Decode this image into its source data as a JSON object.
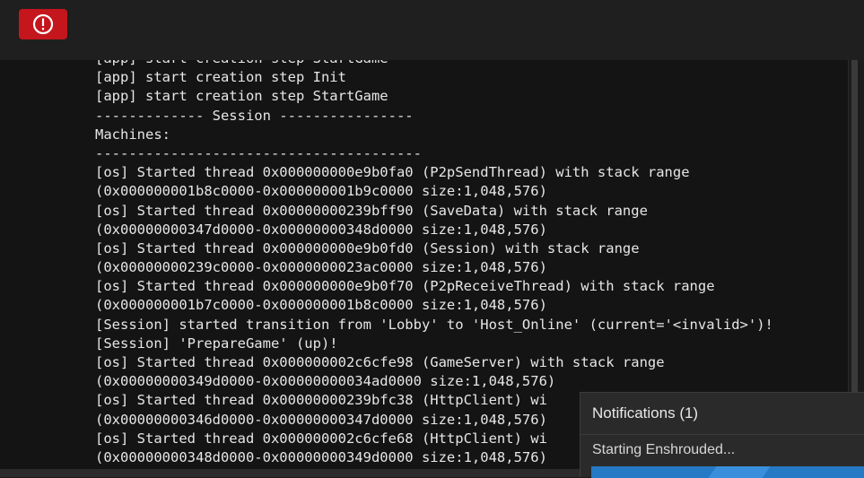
{
  "toolbar": {
    "alert_icon": "error-icon",
    "accent_color": "#c4161c"
  },
  "console": {
    "lines": [
      "[app] start creation step StartGame",
      "[app] start creation step Init",
      "[app] start creation step StartGame",
      "------------- Session ----------------",
      "Machines:",
      "---------------------------------------",
      "[os] Started thread 0x000000000e9b0fa0 (P2pSendThread) with stack range",
      "(0x000000001b8c0000-0x000000001b9c0000 size:1,048,576)",
      "[os] Started thread 0x00000000239bff90 (SaveData) with stack range",
      "(0x00000000347d0000-0x00000000348d0000 size:1,048,576)",
      "[os] Started thread 0x000000000e9b0fd0 (Session) with stack range",
      "(0x00000000239c0000-0x0000000023ac0000 size:1,048,576)",
      "[os] Started thread 0x000000000e9b0f70 (P2pReceiveThread) with stack range",
      "(0x000000001b7c0000-0x000000001b8c0000 size:1,048,576)",
      "[Session] started transition from 'Lobby' to 'Host_Online' (current='<invalid>')!",
      "[Session] 'PrepareGame' (up)!",
      "[os] Started thread 0x000000002c6cfe98 (GameServer) with stack range",
      "(0x00000000349d0000-0x00000000034ad0000 size:1,048,576)",
      "[os] Started thread 0x00000000239bfc38 (HttpClient) wi",
      "(0x00000000346d0000-0x00000000347d0000 size:1,048,576)",
      "[os] Started thread 0x000000002c6cfe68 (HttpClient) wi",
      "(0x00000000348d0000-0x00000000349d0000 size:1,048,576)"
    ]
  },
  "notifications": {
    "title": "Notifications (1)",
    "items": [
      {
        "text": "Starting Enshrouded..."
      }
    ],
    "progress_color": "#2679c4"
  }
}
